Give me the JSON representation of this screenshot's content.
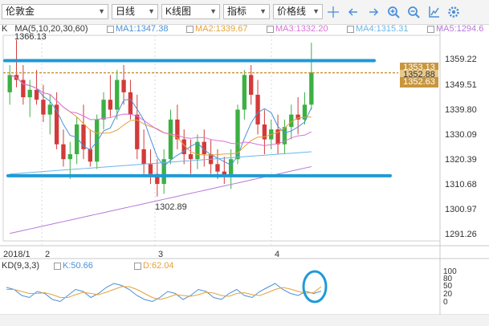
{
  "toolbar": {
    "instrument": "伦敦金",
    "period": "日线",
    "chart_type": "K线图",
    "indicator": "指标",
    "line_type": "价格线",
    "icons": [
      "crosshair-icon",
      "arrow-left-icon",
      "arrow-right-icon",
      "zoom-in-icon",
      "zoom-out-icon",
      "autoscale-icon",
      "settings-icon"
    ]
  },
  "main_legend": {
    "k_label": "K",
    "ma_label": "MA(5,10,20,30,60)",
    "ma1": "MA1:1347.38",
    "ma2": "MA2:1339.67",
    "ma3": "MA3:1332.20",
    "ma4": "MA4:1315.31",
    "ma5": "MA5:1294.6"
  },
  "kd_legend": {
    "label": "KD(9,3,3)",
    "k": "K:50.66",
    "d": "D:62.04"
  },
  "annotations": {
    "high": "1366.13",
    "low": "1302.89"
  },
  "price_axis": [
    "1359.22",
    "1349.51",
    "1339.80",
    "1330.09",
    "1320.39",
    "1310.68",
    "1300.97",
    "1291.26"
  ],
  "price_tags": [
    "1353.13",
    "1352.88",
    "1352.63"
  ],
  "kd_axis": [
    "100",
    "80",
    "50",
    "20",
    "0"
  ],
  "x_labels": [
    "2018/1",
    "2",
    "3",
    "4"
  ],
  "colors": {
    "up": "#3cb043",
    "down": "#d33a3a",
    "ma1": "#4a90d9",
    "ma2": "#e5a23a",
    "ma3": "#d872d8",
    "ma4": "#6bb6e8",
    "ma5": "#b57ad8",
    "support_resistance": "#1f9ad6",
    "current_price": "#c8963e",
    "k_line": "#4a90d9",
    "d_line": "#e5a23a",
    "circle": "#1f9ad6"
  },
  "chart_data": {
    "type": "candlestick",
    "ylim": [
      1285,
      1368
    ],
    "candles": [
      [
        1345,
        1356,
        1340,
        1352
      ],
      [
        1352,
        1366.13,
        1347,
        1350
      ],
      [
        1350,
        1356,
        1340,
        1343
      ],
      [
        1343,
        1350,
        1335,
        1346
      ],
      [
        1346,
        1354,
        1340,
        1342
      ],
      [
        1342,
        1348,
        1333,
        1336
      ],
      [
        1336,
        1344,
        1328,
        1340
      ],
      [
        1340,
        1345,
        1322,
        1324
      ],
      [
        1324,
        1330,
        1315,
        1318
      ],
      [
        1318,
        1325,
        1310,
        1320
      ],
      [
        1320,
        1335,
        1316,
        1332
      ],
      [
        1332,
        1340,
        1318,
        1322
      ],
      [
        1322,
        1330,
        1315,
        1317
      ],
      [
        1317,
        1336,
        1314,
        1334
      ],
      [
        1334,
        1345,
        1330,
        1342
      ],
      [
        1342,
        1352,
        1335,
        1338
      ],
      [
        1338,
        1354,
        1334,
        1350
      ],
      [
        1350,
        1356,
        1340,
        1345
      ],
      [
        1345,
        1350,
        1334,
        1336
      ],
      [
        1336,
        1344,
        1318,
        1322
      ],
      [
        1322,
        1330,
        1312,
        1316
      ],
      [
        1316,
        1322,
        1308,
        1312
      ],
      [
        1312,
        1318,
        1302.89,
        1308
      ],
      [
        1308,
        1322,
        1304,
        1318
      ],
      [
        1318,
        1338,
        1316,
        1334
      ],
      [
        1334,
        1340,
        1322,
        1326
      ],
      [
        1326,
        1330,
        1316,
        1320
      ],
      [
        1320,
        1326,
        1312,
        1318
      ],
      [
        1318,
        1328,
        1314,
        1325
      ],
      [
        1325,
        1330,
        1315,
        1320
      ],
      [
        1320,
        1326,
        1312,
        1316
      ],
      [
        1316,
        1322,
        1310,
        1313
      ],
      [
        1313,
        1319,
        1308,
        1311
      ],
      [
        1311,
        1322,
        1306,
        1318
      ],
      [
        1318,
        1340,
        1316,
        1338
      ],
      [
        1338,
        1354,
        1334,
        1352
      ],
      [
        1352,
        1356,
        1340,
        1344
      ],
      [
        1344,
        1350,
        1328,
        1332
      ],
      [
        1332,
        1338,
        1320,
        1326
      ],
      [
        1326,
        1334,
        1322,
        1330
      ],
      [
        1330,
        1336,
        1320,
        1324
      ],
      [
        1324,
        1334,
        1320,
        1331
      ],
      [
        1331,
        1340,
        1326,
        1336
      ],
      [
        1336,
        1343,
        1328,
        1334
      ],
      [
        1334,
        1345,
        1332,
        1340
      ],
      [
        1340,
        1365,
        1338,
        1353
      ]
    ],
    "resistance": 1357.8,
    "support": 1311.3,
    "current_price": 1352.88,
    "kd": {
      "k": [
        60,
        55,
        40,
        35,
        50,
        45,
        30,
        25,
        40,
        55,
        50,
        35,
        45,
        60,
        70,
        65,
        55,
        40,
        30,
        25,
        35,
        50,
        45,
        30,
        40,
        55,
        50,
        35,
        30,
        45,
        55,
        40,
        35,
        50,
        60,
        70,
        55,
        45,
        40,
        50,
        45,
        50.66
      ],
      "d": [
        55,
        55,
        50,
        45,
        45,
        47,
        42,
        35,
        35,
        42,
        48,
        45,
        42,
        48,
        55,
        62,
        62,
        55,
        45,
        35,
        30,
        35,
        42,
        40,
        38,
        42,
        48,
        46,
        40,
        38,
        45,
        47,
        42,
        40,
        47,
        55,
        60,
        56,
        50,
        46,
        47,
        62.04
      ]
    }
  }
}
